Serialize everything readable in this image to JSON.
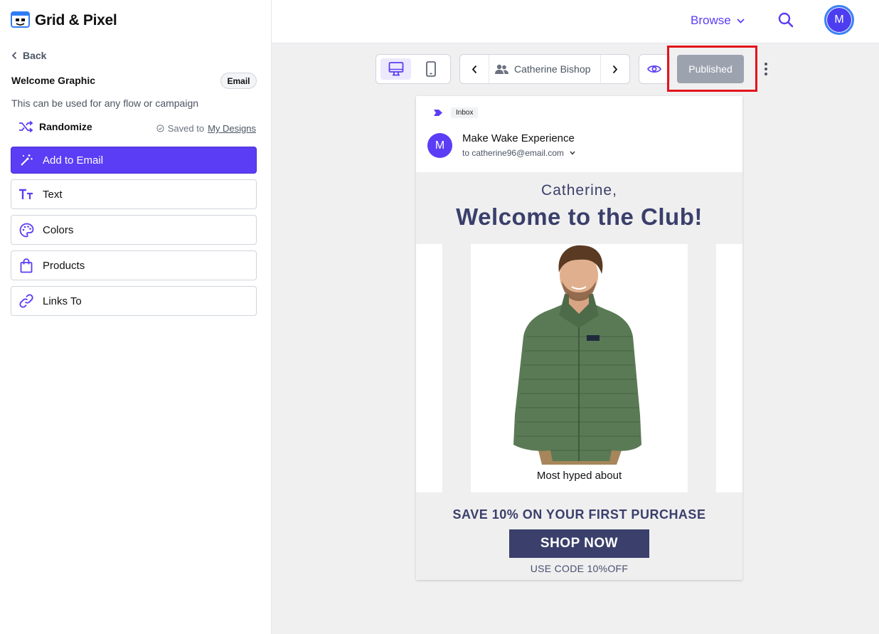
{
  "brand": {
    "name": "Grid & Pixel",
    "accent": "#5b3df5"
  },
  "sidebar": {
    "back_label": "Back",
    "design_title": "Welcome Graphic",
    "badge": "Email",
    "description": "This can be used for any flow or campaign",
    "randomize_label": "Randomize",
    "saved_prefix": "Saved to",
    "saved_link": "My Designs",
    "items": [
      {
        "label": "Add to Email",
        "icon": "magic-wand-icon"
      },
      {
        "label": "Text",
        "icon": "text-icon"
      },
      {
        "label": "Colors",
        "icon": "palette-icon"
      },
      {
        "label": "Products",
        "icon": "shopping-bag-icon"
      },
      {
        "label": "Links To",
        "icon": "link-icon"
      }
    ]
  },
  "topbar": {
    "browse_label": "Browse",
    "avatar_initial": "M"
  },
  "toolbar": {
    "recipient_name": "Catherine Bishop",
    "published_label": "Published"
  },
  "email": {
    "inbox_tag": "Inbox",
    "sender_initial": "M",
    "sender_name": "Make Wake Experience",
    "sender_to": "to catherine96@email.com",
    "greeting": "Catherine,",
    "headline": "Welcome to the Club!",
    "product_caption": "Most hyped about",
    "offer": "SAVE 10% ON YOUR FIRST PURCHASE",
    "cta": "SHOP NOW",
    "code": "USE CODE 10%OFF"
  }
}
